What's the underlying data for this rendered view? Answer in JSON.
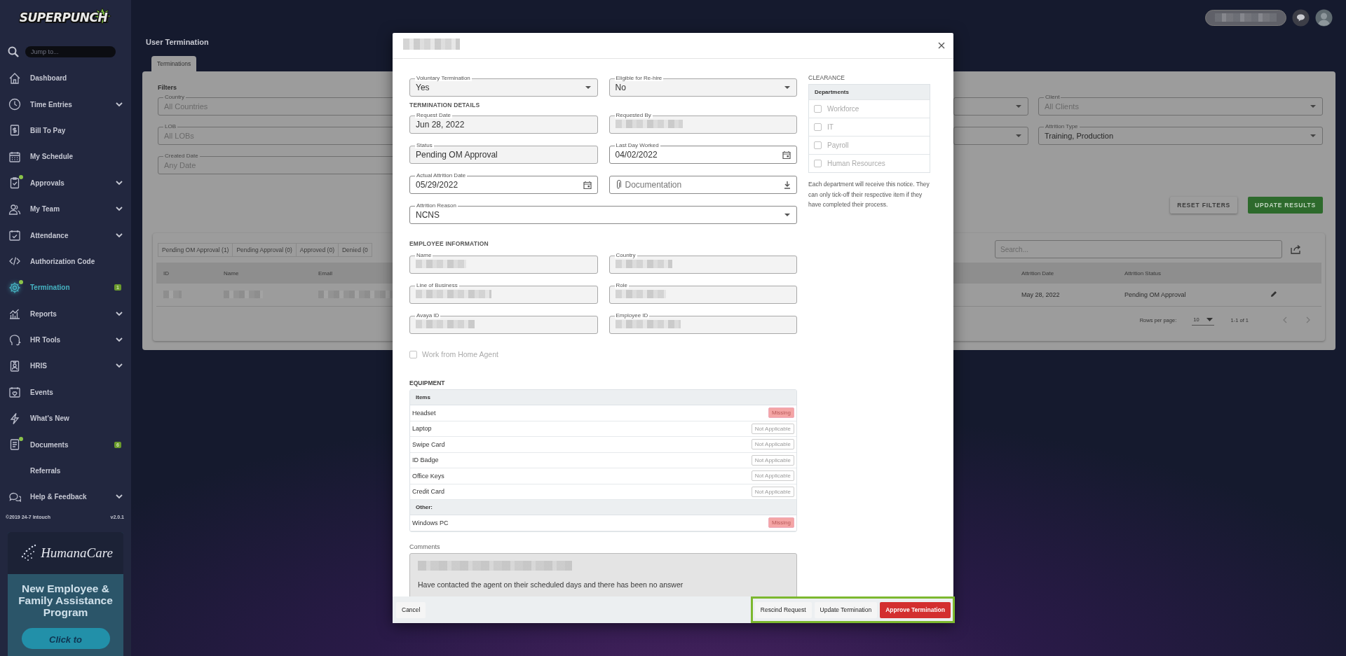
{
  "sidebar": {
    "logo": "SUPERPUNCH",
    "search": {
      "placeholder": "Jump to..."
    },
    "items": [
      {
        "label": "Dashboard",
        "chevron": false,
        "selected": false,
        "dot": false
      },
      {
        "label": "Time Entries",
        "chevron": true,
        "selected": false,
        "dot": false
      },
      {
        "label": "Bill To Pay",
        "chevron": false,
        "selected": false,
        "dot": false
      },
      {
        "label": "My Schedule",
        "chevron": false,
        "selected": false,
        "dot": false
      },
      {
        "label": "Approvals",
        "chevron": true,
        "selected": false,
        "dot": true
      },
      {
        "label": "My Team",
        "chevron": true,
        "selected": false,
        "dot": false
      },
      {
        "label": "Attendance",
        "chevron": true,
        "selected": false,
        "dot": false
      },
      {
        "label": "Authorization Code",
        "chevron": false,
        "selected": false,
        "dot": false
      },
      {
        "label": "Termination",
        "chevron": false,
        "selected": true,
        "dot": true,
        "badge": "1"
      },
      {
        "label": "Reports",
        "chevron": true,
        "selected": false,
        "dot": false
      },
      {
        "label": "HR Tools",
        "chevron": true,
        "selected": false,
        "dot": false
      },
      {
        "label": "HRIS",
        "chevron": true,
        "selected": false,
        "dot": false
      },
      {
        "label": "Events",
        "chevron": false,
        "selected": false,
        "dot": false
      },
      {
        "label": "What's New",
        "chevron": false,
        "selected": false,
        "dot": false
      },
      {
        "label": "Documents",
        "chevron": false,
        "selected": false,
        "dot": true,
        "badge": "6"
      },
      {
        "label": "Referrals",
        "chevron": false,
        "selected": false,
        "dot": false
      },
      {
        "label": "Help & Feedback",
        "chevron": true,
        "selected": false,
        "dot": false
      }
    ],
    "copyright": "©2019 24-7 Intouch",
    "version": "v2.0.1",
    "ad": {
      "brand": "HumanaCare",
      "headline": "New Employee & Family Assistance Program",
      "button": "Click to"
    }
  },
  "topbar": {
    "user": {
      "redacted": true
    }
  },
  "page": {
    "title": "User Termination",
    "tabs": [
      {
        "label": "Terminations",
        "selected": true
      }
    ],
    "filters": {
      "heading": "Filters",
      "left": [
        {
          "label": "Country",
          "placeholder": "All Countries"
        },
        {
          "label": "LOB",
          "placeholder": "All LOBs"
        },
        {
          "label": "Created Date",
          "placeholder": "Any Date"
        }
      ],
      "right": [
        {
          "label": "Client",
          "placeholder": "All Clients",
          "kind": "select"
        },
        {
          "label": "Attrition Type",
          "value": "Training, Production",
          "kind": "select"
        }
      ]
    },
    "buttons": [
      {
        "label": "RESET FILTERS",
        "kind": "secondary"
      },
      {
        "label": "UPDATE RESULTS",
        "kind": "primary"
      }
    ],
    "table": {
      "status_tabs": [
        {
          "label": "Pending OM Approval (1)"
        },
        {
          "label": "Pending Approval (0)"
        },
        {
          "label": "Approved (0)"
        },
        {
          "label": "Denied (0"
        }
      ],
      "search": {
        "placeholder": "Search..."
      },
      "columns": [
        "ID",
        "Name",
        "Email",
        "Attrition Date",
        "Attrition Status"
      ],
      "rows": [
        {
          "cells": [
            {
              "redacted": true
            },
            {
              "redacted": true
            },
            {
              "redacted": true
            },
            {
              "text": "May 28, 2022"
            },
            {
              "text": "Pending OM Approval"
            }
          ]
        }
      ],
      "pagination": {
        "rows_label": "Rows per page:",
        "rows_value": "10",
        "range": "1-1 of 1"
      }
    }
  },
  "modal": {
    "title": {
      "redacted": true
    },
    "top_fields": [
      {
        "label": "Voluntary Termination",
        "value": "Yes",
        "kind": "select",
        "disabled": true
      },
      {
        "label": "Eligible for Re-hire",
        "value": "No",
        "kind": "select",
        "disabled": true
      }
    ],
    "sections": [
      {
        "heading": "TERMINATION DETAILS",
        "fields": [
          {
            "label": "Request Date",
            "value": "Jun 28, 2022",
            "kind": "text",
            "disabled": true
          },
          {
            "label": "Requested By",
            "kind": "text",
            "disabled": true,
            "redacted": true
          },
          {
            "label": "Status",
            "value": "Pending OM Approval",
            "kind": "text",
            "disabled": true
          },
          {
            "label": "Last Day Worked",
            "value": "04/02/2022",
            "kind": "date",
            "disabled": false
          },
          {
            "label": "Actual Attrition Date",
            "value": "05/29/2022",
            "kind": "date",
            "disabled": false
          },
          {
            "placeholder": "Documentation",
            "kind": "file",
            "disabled": false
          },
          {
            "label": "Attrition Reason",
            "value": "NCNS",
            "kind": "select",
            "disabled": false,
            "full": true
          }
        ]
      },
      {
        "heading": "EMPLOYEE INFORMATION",
        "fields": [
          {
            "label": "Name",
            "kind": "text",
            "disabled": true,
            "redacted": true
          },
          {
            "label": "Country",
            "kind": "text",
            "disabled": true,
            "redacted": true
          },
          {
            "label": "Line of Business",
            "kind": "text",
            "disabled": true,
            "redacted": true
          },
          {
            "label": "Role",
            "kind": "text",
            "disabled": true,
            "redacted": true
          },
          {
            "label": "Avaya ID",
            "kind": "text",
            "disabled": true,
            "redacted": true
          },
          {
            "label": "Employee ID",
            "kind": "text",
            "disabled": true,
            "redacted": true
          }
        ]
      }
    ],
    "work_from_home": {
      "label": "Work from Home Agent",
      "checked": false,
      "disabled": true
    },
    "equipment": {
      "heading": "EQUIPMENT",
      "groups": [
        {
          "title": "Items",
          "rows": [
            {
              "name": "Headset",
              "status": "Missing",
              "kind": "missing"
            },
            {
              "name": "Laptop",
              "status": "Not Applicable",
              "kind": "na"
            },
            {
              "name": "Swipe Card",
              "status": "Not Applicable",
              "kind": "na"
            },
            {
              "name": "ID Badge",
              "status": "Not Applicable",
              "kind": "na"
            },
            {
              "name": "Office Keys",
              "status": "Not Applicable",
              "kind": "na"
            },
            {
              "name": "Credit Card",
              "status": "Not Applicable",
              "kind": "na"
            }
          ]
        },
        {
          "title": "Other:",
          "rows": [
            {
              "name": "Windows PC",
              "status": "Missing",
              "kind": "missing"
            }
          ]
        }
      ]
    },
    "comments": {
      "label": "Comments",
      "lines": [
        {
          "redacted": true
        },
        {
          "text": "Have contacted the agent on their scheduled days and there has been no answer"
        }
      ]
    },
    "clearance": {
      "heading": "CLEARANCE",
      "column": "Departments",
      "items": [
        {
          "label": "Workforce",
          "checked": false,
          "disabled": true
        },
        {
          "label": "IT",
          "checked": false,
          "disabled": true
        },
        {
          "label": "Payroll",
          "checked": false,
          "disabled": true
        },
        {
          "label": "Human Resources",
          "checked": false,
          "disabled": true
        }
      ],
      "note": "Each department will receive this notice. They can only tick-off their respective item if they have completed their process."
    },
    "footer": {
      "cancel": "Cancel",
      "highlighted": true,
      "actions": [
        {
          "label": "Rescind Request",
          "kind": "plain"
        },
        {
          "label": "Update Termination",
          "kind": "plain"
        },
        {
          "label": "Approve Termination",
          "kind": "danger"
        }
      ]
    }
  }
}
